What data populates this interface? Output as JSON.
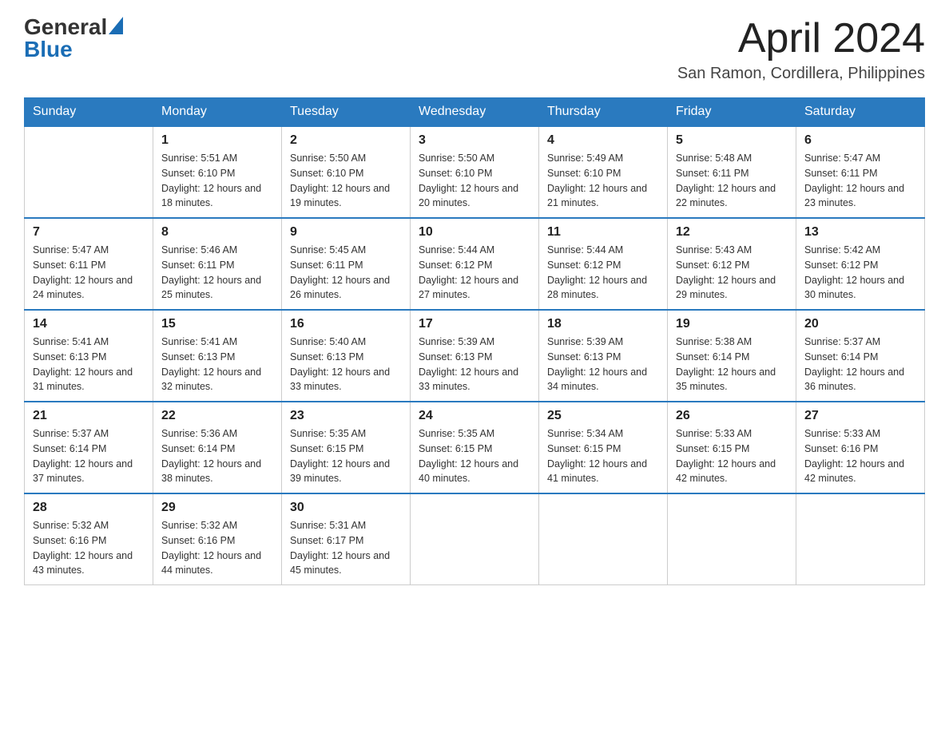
{
  "header": {
    "logo": {
      "general": "General",
      "blue": "Blue"
    },
    "title": "April 2024",
    "location": "San Ramon, Cordillera, Philippines"
  },
  "calendar": {
    "days_of_week": [
      "Sunday",
      "Monday",
      "Tuesday",
      "Wednesday",
      "Thursday",
      "Friday",
      "Saturday"
    ],
    "weeks": [
      [
        null,
        {
          "day": "1",
          "sunrise": "Sunrise: 5:51 AM",
          "sunset": "Sunset: 6:10 PM",
          "daylight": "Daylight: 12 hours and 18 minutes."
        },
        {
          "day": "2",
          "sunrise": "Sunrise: 5:50 AM",
          "sunset": "Sunset: 6:10 PM",
          "daylight": "Daylight: 12 hours and 19 minutes."
        },
        {
          "day": "3",
          "sunrise": "Sunrise: 5:50 AM",
          "sunset": "Sunset: 6:10 PM",
          "daylight": "Daylight: 12 hours and 20 minutes."
        },
        {
          "day": "4",
          "sunrise": "Sunrise: 5:49 AM",
          "sunset": "Sunset: 6:10 PM",
          "daylight": "Daylight: 12 hours and 21 minutes."
        },
        {
          "day": "5",
          "sunrise": "Sunrise: 5:48 AM",
          "sunset": "Sunset: 6:11 PM",
          "daylight": "Daylight: 12 hours and 22 minutes."
        },
        {
          "day": "6",
          "sunrise": "Sunrise: 5:47 AM",
          "sunset": "Sunset: 6:11 PM",
          "daylight": "Daylight: 12 hours and 23 minutes."
        }
      ],
      [
        {
          "day": "7",
          "sunrise": "Sunrise: 5:47 AM",
          "sunset": "Sunset: 6:11 PM",
          "daylight": "Daylight: 12 hours and 24 minutes."
        },
        {
          "day": "8",
          "sunrise": "Sunrise: 5:46 AM",
          "sunset": "Sunset: 6:11 PM",
          "daylight": "Daylight: 12 hours and 25 minutes."
        },
        {
          "day": "9",
          "sunrise": "Sunrise: 5:45 AM",
          "sunset": "Sunset: 6:11 PM",
          "daylight": "Daylight: 12 hours and 26 minutes."
        },
        {
          "day": "10",
          "sunrise": "Sunrise: 5:44 AM",
          "sunset": "Sunset: 6:12 PM",
          "daylight": "Daylight: 12 hours and 27 minutes."
        },
        {
          "day": "11",
          "sunrise": "Sunrise: 5:44 AM",
          "sunset": "Sunset: 6:12 PM",
          "daylight": "Daylight: 12 hours and 28 minutes."
        },
        {
          "day": "12",
          "sunrise": "Sunrise: 5:43 AM",
          "sunset": "Sunset: 6:12 PM",
          "daylight": "Daylight: 12 hours and 29 minutes."
        },
        {
          "day": "13",
          "sunrise": "Sunrise: 5:42 AM",
          "sunset": "Sunset: 6:12 PM",
          "daylight": "Daylight: 12 hours and 30 minutes."
        }
      ],
      [
        {
          "day": "14",
          "sunrise": "Sunrise: 5:41 AM",
          "sunset": "Sunset: 6:13 PM",
          "daylight": "Daylight: 12 hours and 31 minutes."
        },
        {
          "day": "15",
          "sunrise": "Sunrise: 5:41 AM",
          "sunset": "Sunset: 6:13 PM",
          "daylight": "Daylight: 12 hours and 32 minutes."
        },
        {
          "day": "16",
          "sunrise": "Sunrise: 5:40 AM",
          "sunset": "Sunset: 6:13 PM",
          "daylight": "Daylight: 12 hours and 33 minutes."
        },
        {
          "day": "17",
          "sunrise": "Sunrise: 5:39 AM",
          "sunset": "Sunset: 6:13 PM",
          "daylight": "Daylight: 12 hours and 33 minutes."
        },
        {
          "day": "18",
          "sunrise": "Sunrise: 5:39 AM",
          "sunset": "Sunset: 6:13 PM",
          "daylight": "Daylight: 12 hours and 34 minutes."
        },
        {
          "day": "19",
          "sunrise": "Sunrise: 5:38 AM",
          "sunset": "Sunset: 6:14 PM",
          "daylight": "Daylight: 12 hours and 35 minutes."
        },
        {
          "day": "20",
          "sunrise": "Sunrise: 5:37 AM",
          "sunset": "Sunset: 6:14 PM",
          "daylight": "Daylight: 12 hours and 36 minutes."
        }
      ],
      [
        {
          "day": "21",
          "sunrise": "Sunrise: 5:37 AM",
          "sunset": "Sunset: 6:14 PM",
          "daylight": "Daylight: 12 hours and 37 minutes."
        },
        {
          "day": "22",
          "sunrise": "Sunrise: 5:36 AM",
          "sunset": "Sunset: 6:14 PM",
          "daylight": "Daylight: 12 hours and 38 minutes."
        },
        {
          "day": "23",
          "sunrise": "Sunrise: 5:35 AM",
          "sunset": "Sunset: 6:15 PM",
          "daylight": "Daylight: 12 hours and 39 minutes."
        },
        {
          "day": "24",
          "sunrise": "Sunrise: 5:35 AM",
          "sunset": "Sunset: 6:15 PM",
          "daylight": "Daylight: 12 hours and 40 minutes."
        },
        {
          "day": "25",
          "sunrise": "Sunrise: 5:34 AM",
          "sunset": "Sunset: 6:15 PM",
          "daylight": "Daylight: 12 hours and 41 minutes."
        },
        {
          "day": "26",
          "sunrise": "Sunrise: 5:33 AM",
          "sunset": "Sunset: 6:15 PM",
          "daylight": "Daylight: 12 hours and 42 minutes."
        },
        {
          "day": "27",
          "sunrise": "Sunrise: 5:33 AM",
          "sunset": "Sunset: 6:16 PM",
          "daylight": "Daylight: 12 hours and 42 minutes."
        }
      ],
      [
        {
          "day": "28",
          "sunrise": "Sunrise: 5:32 AM",
          "sunset": "Sunset: 6:16 PM",
          "daylight": "Daylight: 12 hours and 43 minutes."
        },
        {
          "day": "29",
          "sunrise": "Sunrise: 5:32 AM",
          "sunset": "Sunset: 6:16 PM",
          "daylight": "Daylight: 12 hours and 44 minutes."
        },
        {
          "day": "30",
          "sunrise": "Sunrise: 5:31 AM",
          "sunset": "Sunset: 6:17 PM",
          "daylight": "Daylight: 12 hours and 45 minutes."
        },
        null,
        null,
        null,
        null
      ]
    ]
  }
}
